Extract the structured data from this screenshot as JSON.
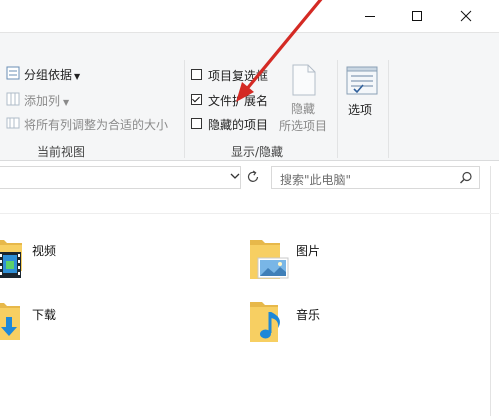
{
  "window": {
    "minimize_icon": "minimize-icon",
    "maximize_icon": "maximize-icon",
    "close_icon": "close-icon",
    "help_icon": "help-icon"
  },
  "ribbon": {
    "current_view": {
      "group_label": "当前视图",
      "group_by": "分组依据",
      "add_column": "添加列",
      "fit_columns": "将所有列调整为合适的大小"
    },
    "show_hide": {
      "group_label": "显示/隐藏",
      "item_checkboxes": {
        "label": "项目复选框",
        "checked": false
      },
      "file_extensions": {
        "label": "文件扩展名",
        "checked": true
      },
      "hidden_items": {
        "label": "隐藏的项目",
        "checked": false
      },
      "hide_selected_line1": "隐藏",
      "hide_selected_line2": "所选项目"
    },
    "options": {
      "label": "选项"
    }
  },
  "address": {
    "search_placeholder": "搜索\"此电脑\""
  },
  "folders": [
    {
      "name": "视频",
      "icon": "video-folder-icon"
    },
    {
      "name": "图片",
      "icon": "pictures-folder-icon"
    },
    {
      "name": "下载",
      "icon": "downloads-folder-icon"
    },
    {
      "name": "音乐",
      "icon": "music-folder-icon"
    }
  ],
  "colors": {
    "annotation_arrow": "#d42a24",
    "folder_yellow": "#f7cf62",
    "accent_blue": "#1e88d8"
  }
}
